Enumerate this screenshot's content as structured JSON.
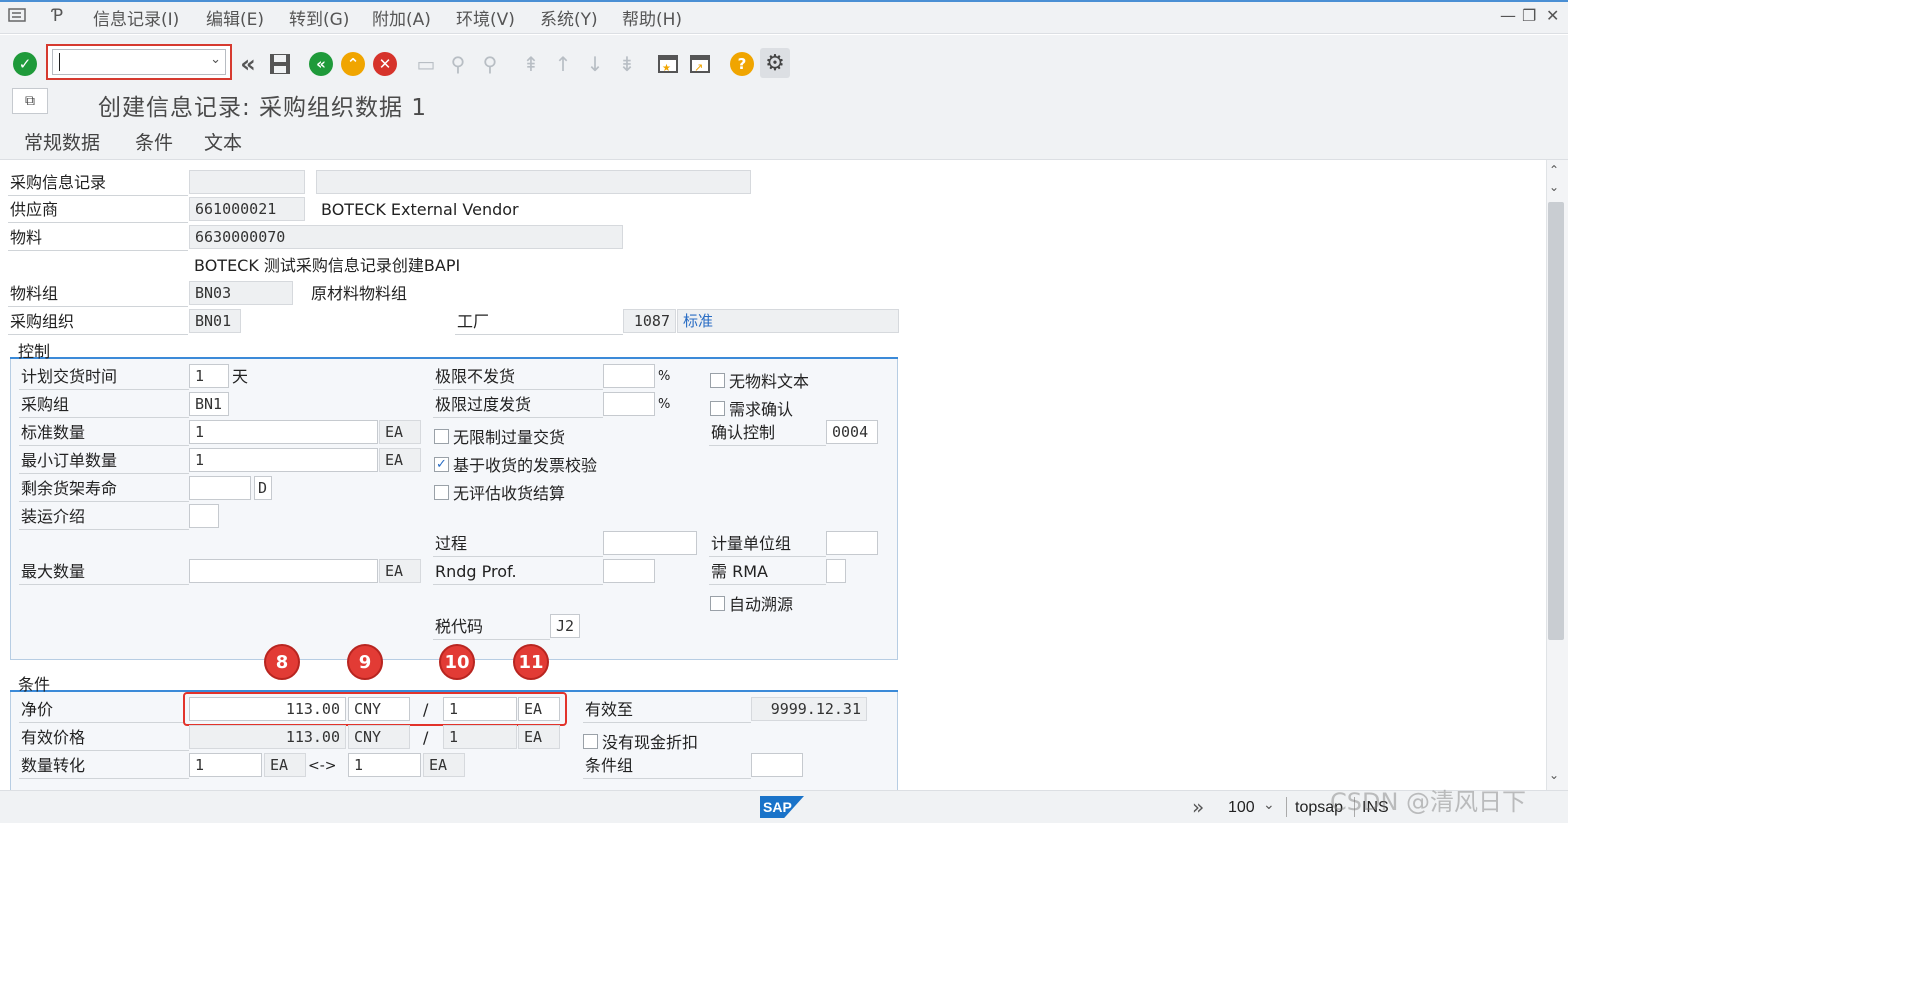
{
  "menu": {
    "items": [
      "信息记录(I)",
      "编辑(E)",
      "转到(G)",
      "附加(A)",
      "环境(V)",
      "系统(Y)",
      "帮助(H)"
    ]
  },
  "toolbar": {
    "command_value": "",
    "icons": [
      "check-icon",
      "command-field",
      "back-arrows-icon",
      "save-icon",
      "back-icon",
      "exit-icon",
      "cancel-icon",
      "print-icon",
      "find-icon",
      "find-next-icon",
      "first-page-icon",
      "prev-page-icon",
      "next-page-icon",
      "last-page-icon",
      "new-session-icon",
      "shortcut-icon",
      "help-icon",
      "settings-icon"
    ]
  },
  "title": "创建信息记录: 采购组织数据 1",
  "tabs": [
    "常规数据",
    "条件",
    "文本"
  ],
  "header": {
    "info_record_label": "采购信息记录",
    "info_record_value": "",
    "info_record_desc": "",
    "vendor_label": "供应商",
    "vendor_value": "661000021",
    "vendor_name": "BOTECK External Vendor",
    "material_label": "物料",
    "material_value": "6630000070",
    "material_desc": "BOTECK 测试采购信息记录创建BAPI",
    "material_group_label": "物料组",
    "material_group_value": "BN03",
    "material_group_desc": "原材料物料组",
    "purch_org_label": "采购组织",
    "purch_org_value": "BN01",
    "plant_label": "工厂",
    "plant_value": "1087",
    "plant_type": "标准"
  },
  "control": {
    "section_title": "控制",
    "planned_delivery_label": "计划交货时间",
    "planned_delivery_value": "1",
    "planned_delivery_unit": "天",
    "purch_group_label": "采购组",
    "purch_group_value": "BN1",
    "std_qty_label": "标准数量",
    "std_qty_value": "1",
    "std_qty_unit": "EA",
    "min_qty_label": "最小订单数量",
    "min_qty_value": "1",
    "min_qty_unit": "EA",
    "shelf_life_label": "剩余货架寿命",
    "shelf_life_value": "",
    "shelf_life_unit": "D",
    "shipping_label": "装运介绍",
    "shipping_value": "",
    "max_qty_label": "最大数量",
    "max_qty_value": "",
    "max_qty_unit": "EA",
    "underdel_label": "极限不发货",
    "underdel_value": "",
    "underdel_unit": "%",
    "overdel_label": "极限过度发货",
    "overdel_value": "",
    "overdel_unit": "%",
    "unlimited_label": "无限制过量交货",
    "unlimited_checked": false,
    "gr_iv_label": "基于收货的发票校验",
    "gr_iv_checked": true,
    "no_eval_label": "无评估收货结算",
    "no_eval_checked": false,
    "procedure_label": "过程",
    "procedure_value": "",
    "rndg_label": "Rndg Prof.",
    "rndg_value": "",
    "tax_label": "税代码",
    "tax_value": "J2",
    "no_mat_text_label": "无物料文本",
    "no_mat_text_checked": false,
    "ack_req_label": "需求确认",
    "ack_req_checked": false,
    "conf_ctrl_label": "确认控制",
    "conf_ctrl_value": "0004",
    "uom_group_label": "计量单位组",
    "uom_group_value": "",
    "rma_label": "需 RMA",
    "rma_value": "",
    "auto_source_label": "自动溯源",
    "auto_source_checked": false
  },
  "conditions": {
    "section_title": "条件",
    "badges": [
      "8",
      "9",
      "10",
      "11"
    ],
    "net_price_label": "净价",
    "net_price_value": "113.00",
    "net_price_currency": "CNY",
    "net_price_slash": "/",
    "net_price_per": "1",
    "net_price_unit": "EA",
    "valid_to_label": "有效至",
    "valid_to_value": "9999.12.31",
    "eff_price_label": "有效价格",
    "eff_price_value": "113.00",
    "eff_price_currency": "CNY",
    "eff_price_slash": "/",
    "eff_price_per": "1",
    "eff_price_unit": "EA",
    "no_cash_disc_label": "没有现金折扣",
    "no_cash_disc_checked": false,
    "qty_conv_label": "数量转化",
    "qty_conv_left": "1",
    "qty_conv_left_unit": "EA",
    "qty_conv_arrow": "<->",
    "qty_conv_right": "1",
    "qty_conv_right_unit": "EA",
    "cond_group_label": "条件组",
    "cond_group_value": ""
  },
  "status": {
    "logo": "SAP",
    "zoom": "100",
    "system": "topsap",
    "mode": "INS",
    "watermark": "CSDN @清风日下"
  }
}
